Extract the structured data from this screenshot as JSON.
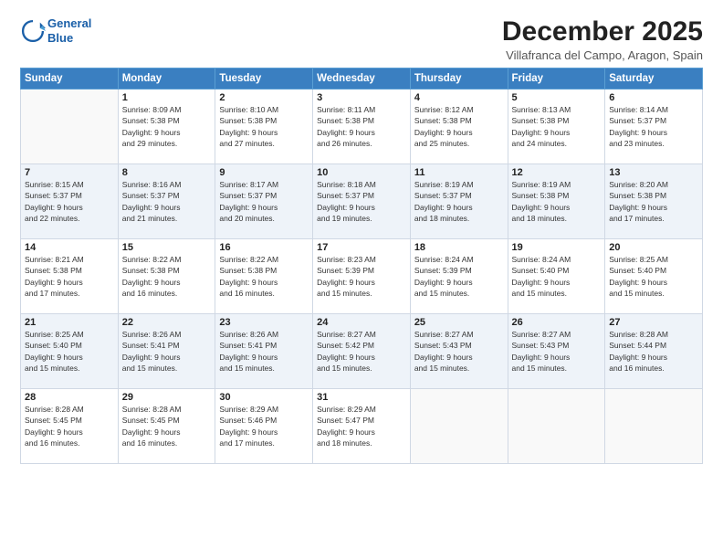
{
  "logo": {
    "line1": "General",
    "line2": "Blue"
  },
  "title": "December 2025",
  "subtitle": "Villafranca del Campo, Aragon, Spain",
  "weekdays": [
    "Sunday",
    "Monday",
    "Tuesday",
    "Wednesday",
    "Thursday",
    "Friday",
    "Saturday"
  ],
  "weeks": [
    [
      {
        "day": "",
        "info": ""
      },
      {
        "day": "1",
        "info": "Sunrise: 8:09 AM\nSunset: 5:38 PM\nDaylight: 9 hours\nand 29 minutes."
      },
      {
        "day": "2",
        "info": "Sunrise: 8:10 AM\nSunset: 5:38 PM\nDaylight: 9 hours\nand 27 minutes."
      },
      {
        "day": "3",
        "info": "Sunrise: 8:11 AM\nSunset: 5:38 PM\nDaylight: 9 hours\nand 26 minutes."
      },
      {
        "day": "4",
        "info": "Sunrise: 8:12 AM\nSunset: 5:38 PM\nDaylight: 9 hours\nand 25 minutes."
      },
      {
        "day": "5",
        "info": "Sunrise: 8:13 AM\nSunset: 5:38 PM\nDaylight: 9 hours\nand 24 minutes."
      },
      {
        "day": "6",
        "info": "Sunrise: 8:14 AM\nSunset: 5:37 PM\nDaylight: 9 hours\nand 23 minutes."
      }
    ],
    [
      {
        "day": "7",
        "info": "Sunrise: 8:15 AM\nSunset: 5:37 PM\nDaylight: 9 hours\nand 22 minutes."
      },
      {
        "day": "8",
        "info": "Sunrise: 8:16 AM\nSunset: 5:37 PM\nDaylight: 9 hours\nand 21 minutes."
      },
      {
        "day": "9",
        "info": "Sunrise: 8:17 AM\nSunset: 5:37 PM\nDaylight: 9 hours\nand 20 minutes."
      },
      {
        "day": "10",
        "info": "Sunrise: 8:18 AM\nSunset: 5:37 PM\nDaylight: 9 hours\nand 19 minutes."
      },
      {
        "day": "11",
        "info": "Sunrise: 8:19 AM\nSunset: 5:37 PM\nDaylight: 9 hours\nand 18 minutes."
      },
      {
        "day": "12",
        "info": "Sunrise: 8:19 AM\nSunset: 5:38 PM\nDaylight: 9 hours\nand 18 minutes."
      },
      {
        "day": "13",
        "info": "Sunrise: 8:20 AM\nSunset: 5:38 PM\nDaylight: 9 hours\nand 17 minutes."
      }
    ],
    [
      {
        "day": "14",
        "info": "Sunrise: 8:21 AM\nSunset: 5:38 PM\nDaylight: 9 hours\nand 17 minutes."
      },
      {
        "day": "15",
        "info": "Sunrise: 8:22 AM\nSunset: 5:38 PM\nDaylight: 9 hours\nand 16 minutes."
      },
      {
        "day": "16",
        "info": "Sunrise: 8:22 AM\nSunset: 5:38 PM\nDaylight: 9 hours\nand 16 minutes."
      },
      {
        "day": "17",
        "info": "Sunrise: 8:23 AM\nSunset: 5:39 PM\nDaylight: 9 hours\nand 15 minutes."
      },
      {
        "day": "18",
        "info": "Sunrise: 8:24 AM\nSunset: 5:39 PM\nDaylight: 9 hours\nand 15 minutes."
      },
      {
        "day": "19",
        "info": "Sunrise: 8:24 AM\nSunset: 5:40 PM\nDaylight: 9 hours\nand 15 minutes."
      },
      {
        "day": "20",
        "info": "Sunrise: 8:25 AM\nSunset: 5:40 PM\nDaylight: 9 hours\nand 15 minutes."
      }
    ],
    [
      {
        "day": "21",
        "info": "Sunrise: 8:25 AM\nSunset: 5:40 PM\nDaylight: 9 hours\nand 15 minutes."
      },
      {
        "day": "22",
        "info": "Sunrise: 8:26 AM\nSunset: 5:41 PM\nDaylight: 9 hours\nand 15 minutes."
      },
      {
        "day": "23",
        "info": "Sunrise: 8:26 AM\nSunset: 5:41 PM\nDaylight: 9 hours\nand 15 minutes."
      },
      {
        "day": "24",
        "info": "Sunrise: 8:27 AM\nSunset: 5:42 PM\nDaylight: 9 hours\nand 15 minutes."
      },
      {
        "day": "25",
        "info": "Sunrise: 8:27 AM\nSunset: 5:43 PM\nDaylight: 9 hours\nand 15 minutes."
      },
      {
        "day": "26",
        "info": "Sunrise: 8:27 AM\nSunset: 5:43 PM\nDaylight: 9 hours\nand 15 minutes."
      },
      {
        "day": "27",
        "info": "Sunrise: 8:28 AM\nSunset: 5:44 PM\nDaylight: 9 hours\nand 16 minutes."
      }
    ],
    [
      {
        "day": "28",
        "info": "Sunrise: 8:28 AM\nSunset: 5:45 PM\nDaylight: 9 hours\nand 16 minutes."
      },
      {
        "day": "29",
        "info": "Sunrise: 8:28 AM\nSunset: 5:45 PM\nDaylight: 9 hours\nand 16 minutes."
      },
      {
        "day": "30",
        "info": "Sunrise: 8:29 AM\nSunset: 5:46 PM\nDaylight: 9 hours\nand 17 minutes."
      },
      {
        "day": "31",
        "info": "Sunrise: 8:29 AM\nSunset: 5:47 PM\nDaylight: 9 hours\nand 18 minutes."
      },
      {
        "day": "",
        "info": ""
      },
      {
        "day": "",
        "info": ""
      },
      {
        "day": "",
        "info": ""
      }
    ]
  ]
}
